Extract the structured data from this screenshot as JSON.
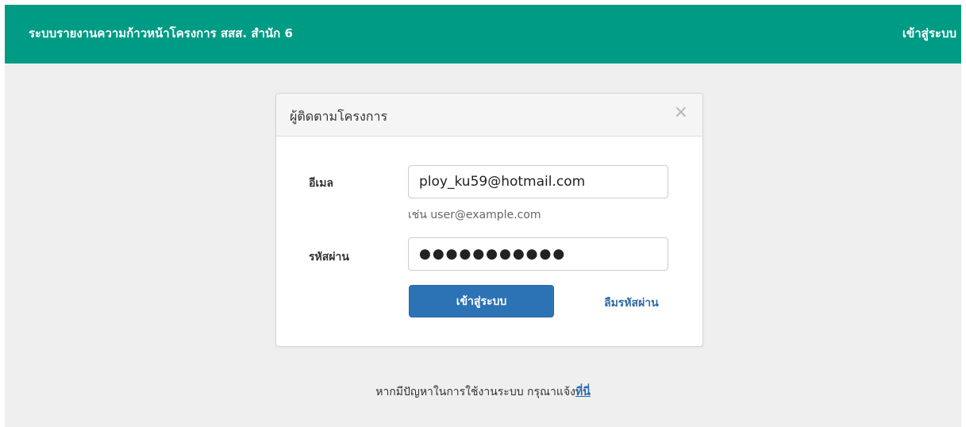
{
  "header": {
    "brand": "ระบบรายงานความก้าวหน้าโครงการ สสส. สำนัก 6",
    "login_label": "เข้าสู่ระบบ"
  },
  "modal": {
    "title": "ผู้ติดตามโครงการ",
    "close_glyph": "×",
    "email_label": "อีเมล",
    "email_value": "ploy_ku59@hotmail.com",
    "email_hint": "เช่น user@example.com",
    "password_label": "รหัสผ่าน",
    "password_mask": "●●●●●●●●●●●",
    "submit_label": "เข้าสู่ระบบ",
    "forgot_label": "ลืมรหัสผ่าน"
  },
  "footer": {
    "text": "หากมีปัญหาในการใช้งานระบบ กรุณาแจ้ง",
    "link_label": "ที่นี่"
  },
  "colors": {
    "navbar": "#009b85",
    "page_background": "#efefef",
    "primary_button": "#2c73b6",
    "link": "#2c6aa8"
  }
}
